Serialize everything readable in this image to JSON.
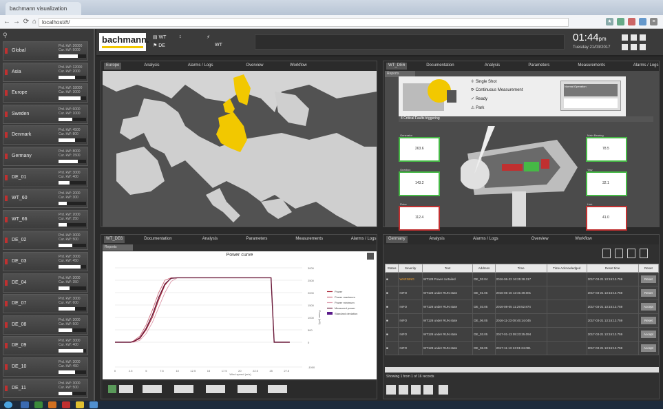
{
  "browser": {
    "tab_title": "bachmann visualization",
    "url": "localhost/#/"
  },
  "sidebar": {
    "search_icon": "search-icon",
    "items": [
      {
        "label": "Global",
        "v1": "Prd. kW: 26000",
        "v2": "Cur. kW: 5000",
        "fill": 0.7
      },
      {
        "label": "Asia",
        "v1": "Prd. kW: 12000",
        "v2": "Cur. kW: 2000",
        "fill": 0.6
      },
      {
        "label": "Europe",
        "v1": "Prd. kW: 18000",
        "v2": "Cur. kW: 3000",
        "fill": 0.8
      },
      {
        "label": "Sweden",
        "v1": "Prd. kW: 6000",
        "v2": "Cur. kW: 1000",
        "fill": 0.5
      },
      {
        "label": "Denmark",
        "v1": "Prd. kW: 4500",
        "v2": "Cur. kW: 800",
        "fill": 0.6
      },
      {
        "label": "Germany",
        "v1": "Prd. kW: 8000",
        "v2": "Cur. kW: 1500",
        "fill": 0.7
      },
      {
        "label": "DE_01",
        "v1": "Prd. kW: 3000",
        "v2": "Cur. kW: 400",
        "fill": 0.4
      },
      {
        "label": "WT_60",
        "v1": "Prd. kW: 2000",
        "v2": "Cur. kW: 300",
        "fill": 0.3
      },
      {
        "label": "WT_66",
        "v1": "Prd. kW: 2000",
        "v2": "Cur. kW: 250",
        "fill": 0.3
      },
      {
        "label": "DE_02",
        "v1": "Prd. kW: 3000",
        "v2": "Cur. kW: 500",
        "fill": 0.5
      },
      {
        "label": "DE_03",
        "v1": "Prd. kW: 3000",
        "v2": "Cur. kW: 450",
        "fill": 0.8
      },
      {
        "label": "DE_04",
        "v1": "Prd. kW: 3000",
        "v2": "Cur. kW: 350",
        "fill": 0.4
      },
      {
        "label": "DE_07",
        "v1": "Prd. kW: 3000",
        "v2": "Cur. kW: 600",
        "fill": 0.6
      },
      {
        "label": "DE_08",
        "v1": "Prd. kW: 3000",
        "v2": "Cur. kW: 500",
        "fill": 0.5
      },
      {
        "label": "DE_09",
        "v1": "Prd. kW: 3000",
        "v2": "Cur. kW: 400",
        "fill": 0.9
      },
      {
        "label": "DE_10",
        "v1": "Prd. kW: 3000",
        "v2": "Cur. kW: 450",
        "fill": 0.6
      },
      {
        "label": "DE_11",
        "v1": "Prd. kW: 3000",
        "v2": "Cur. kW: 500",
        "fill": 0.5
      }
    ]
  },
  "header": {
    "logo": "bachmann.",
    "i1": "WT",
    "i2": "DE",
    "i3": "WT",
    "clock": "01:44",
    "clock_suffix": "pm",
    "date": "Tuesday 21/03/2017"
  },
  "map": {
    "tabs": [
      "Europe",
      "Analysis",
      "Alarms / Logs",
      "Overview",
      "Workflow"
    ],
    "highlight_color": "#f2c800"
  },
  "turbine": {
    "tabs": [
      "WT_DE6",
      "Documentation",
      "Analysis",
      "Parameters",
      "Measurements",
      "Alarms / Logs"
    ],
    "reports_label": "Reports",
    "menu": [
      "Single Shot",
      "Continuous Measurement",
      "Ready",
      "Park"
    ],
    "section_title": "4 Critical Faults triggering",
    "box_text": "Normal Operation",
    "cards": [
      {
        "label": "Generator",
        "value": "263.6"
      },
      {
        "label": "Gearbox",
        "value": "143.2"
      },
      {
        "label": "Rotor",
        "value": "112.4"
      },
      {
        "label": "Main Bearing",
        "value": "78.5"
      },
      {
        "label": "Yaw",
        "value": "32.1"
      },
      {
        "label": "Hub",
        "value": "41.0"
      }
    ]
  },
  "chart": {
    "tabs": [
      "WT_DE6",
      "Documentation",
      "Analysis",
      "Parameters",
      "Measurements",
      "Alarms / Logs"
    ],
    "reports_label": "Reports",
    "title": "Power curve",
    "legend": [
      "Power",
      "Power maximum",
      "Power minimum",
      "Measured power",
      "Standard deviation"
    ]
  },
  "chart_data": {
    "type": "line",
    "title": "Power curve",
    "xlabel": "Wind speed (m/s)",
    "ylabel": "Power (kW)",
    "xlim": [
      0,
      30
    ],
    "ylim": [
      -1000,
      3000
    ],
    "x": [
      0,
      2.5,
      3,
      4,
      5,
      6,
      7,
      8,
      9,
      10,
      11,
      12,
      14,
      16,
      18,
      20,
      22,
      24,
      25,
      25.5,
      27,
      28
    ],
    "series": [
      {
        "name": "Power",
        "values": [
          0,
          0,
          20,
          150,
          500,
          1000,
          1700,
          2300,
          2600,
          2600,
          2600,
          2600,
          2600,
          2600,
          2600,
          2600,
          2600,
          2600,
          2600,
          0,
          0,
          0
        ]
      },
      {
        "name": "Power maximum",
        "values": [
          0,
          0,
          60,
          250,
          700,
          1300,
          2000,
          2500,
          2600,
          2600,
          2600,
          2600,
          2600,
          2600,
          2600,
          2600,
          2600,
          2600,
          2600,
          0,
          0,
          0
        ]
      },
      {
        "name": "Power minimum",
        "values": [
          0,
          0,
          0,
          80,
          350,
          800,
          1400,
          2000,
          2450,
          2600,
          2600,
          2600,
          2600,
          2600,
          2600,
          2600,
          2600,
          2600,
          2600,
          0,
          0,
          0
        ]
      },
      {
        "name": "Measured power",
        "values": [
          0,
          0,
          30,
          180,
          560,
          1100,
          1800,
          2350,
          2580,
          2600,
          2600,
          2600,
          2600,
          2600,
          2600,
          2600,
          2600,
          2600,
          2600,
          0,
          0,
          0
        ]
      }
    ],
    "colors": [
      "#aa2233",
      "#cc6677",
      "#dd99aa",
      "#6a1a3a"
    ],
    "yticks": [
      3000,
      2500,
      2000,
      1500,
      1000,
      500,
      0,
      -1000
    ],
    "xticks": [
      0,
      2.5,
      5,
      7.5,
      10,
      12.5,
      15,
      17.5,
      20,
      22.5,
      25,
      27.5
    ]
  },
  "alarms": {
    "tabs": [
      "Germany",
      "Analysis",
      "Alarms / Logs",
      "Overview",
      "Workflow"
    ],
    "headers": [
      "Status",
      "Severity",
      "Text",
      "Address",
      "Time",
      "Time Acknowledged",
      "Reset time",
      "Reset"
    ],
    "rows": [
      {
        "sev": "WARNING",
        "text": "WT128 Power curtailed",
        "addr": "DE_02.04",
        "time": "2016-06-22 16:25:28.317",
        "ack": "",
        "reset": "2017-03-21 13:15:13.759",
        "btn": "Reset"
      },
      {
        "sev": "INFO",
        "text": "WT128 under RUN state",
        "addr": "DE_01.06",
        "time": "2016-06-16 12:31:39.001",
        "ack": "",
        "reset": "2017-03-21 13:15:13.759",
        "btn": "Reset"
      },
      {
        "sev": "INFO",
        "text": "WT128 under RUN state",
        "addr": "DE_03.05",
        "time": "2016-08-05 11:29:52.874",
        "ack": "",
        "reset": "2017-03-21 13:15:13.759",
        "btn": "Accept"
      },
      {
        "sev": "INFO",
        "text": "WT128 under RUN state",
        "addr": "DE_06.05",
        "time": "2016-11-23 08:45:14.045",
        "ack": "",
        "reset": "2017-03-21 13:15:13.759",
        "btn": "Reset"
      },
      {
        "sev": "INFO",
        "text": "WT128 under RUN state",
        "addr": "DE_03.05",
        "time": "2017-01-13 05:23:25.094",
        "ack": "",
        "reset": "2017-03-21 13:15:13.759",
        "btn": "Accept"
      },
      {
        "sev": "INFO",
        "text": "WT128 under RUN state",
        "addr": "DE_06.05",
        "time": "2017-11-13 13:01:24.081",
        "ack": "",
        "reset": "2017-03-21 13:15:13.759",
        "btn": "Accept"
      }
    ],
    "footer": "Showing 1 from 1 of 16 records"
  }
}
